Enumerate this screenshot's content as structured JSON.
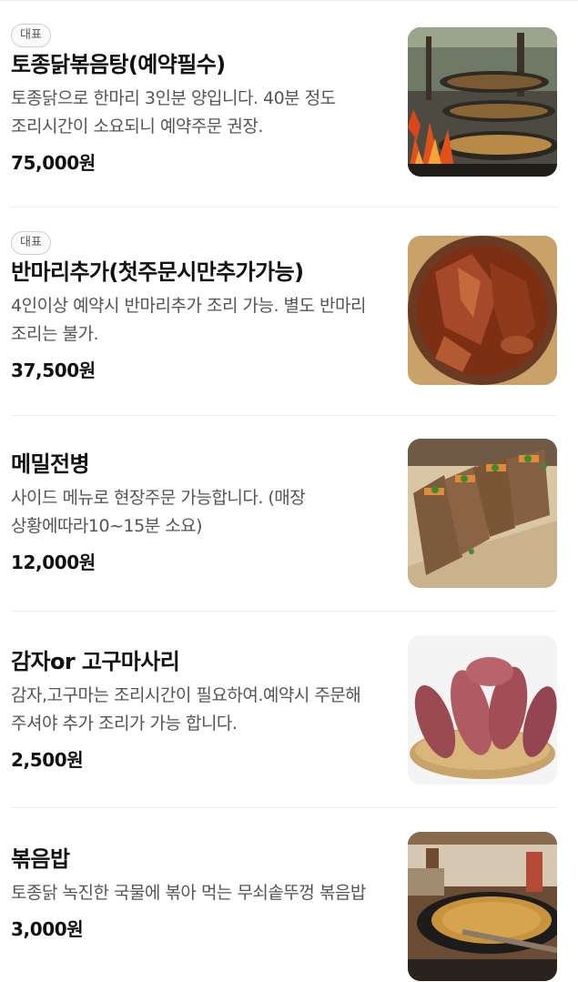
{
  "menu": {
    "items": [
      {
        "badge": "대표",
        "name": "토종닭볶음탕(예약필수)",
        "description": "토종닭으로 한마리 3인분 양입니다. 40분 정도 조리시간이 소요되니 예약주문 권장.",
        "price": "75,000원",
        "image": "fire-pan-photo"
      },
      {
        "badge": "대표",
        "name": "반마리추가(첫주문시만추가가능)",
        "description": "4인이상 예약시 반마리추가 조리 가능. 별도 반마리 조리는 불가.",
        "price": "37,500원",
        "image": "braised-chicken-photo"
      },
      {
        "badge": "",
        "name": "메밀전병",
        "description": "사이드 메뉴로 현장주문 가능합니다. (매장 상황에따라10~15분 소요)",
        "price": "12,000원",
        "image": "buckwheat-crepe-photo"
      },
      {
        "badge": "",
        "name": "감자or 고구마사리",
        "description": "감자,고구마는 조리시간이 필요하여.예약시 주문해 주셔야 추가 조리가 가능 합니다.",
        "price": "2,500원",
        "image": "sweet-potato-photo"
      },
      {
        "badge": "",
        "name": "볶음밥",
        "description": "토종닭 녹진한 국물에 볶아 먹는 무쇠솥뚜껑 볶음밥",
        "price": "3,000원",
        "image": "fried-rice-photo"
      }
    ]
  }
}
